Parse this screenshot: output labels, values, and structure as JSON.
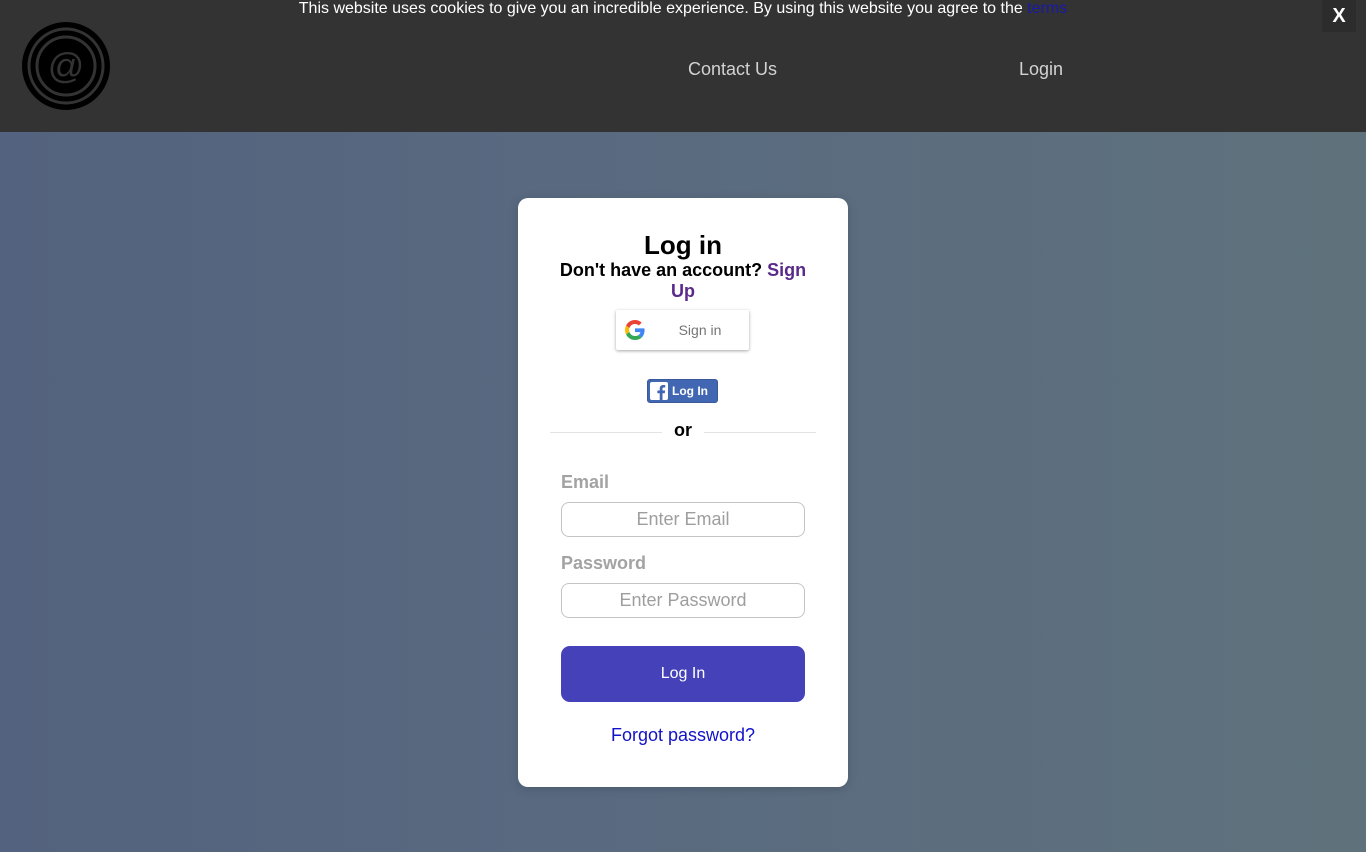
{
  "cookie_banner": {
    "text": "This website uses cookies to give you an incredible experience. By using this website you agree to the",
    "link_text": "terms",
    "close_label": "X"
  },
  "nav": {
    "logo_icon": "at-sign-target-icon",
    "contact_label": "Contact Us",
    "login_label": "Login"
  },
  "login_card": {
    "title": "Log in",
    "no_account_text": "Don't have an account?",
    "sign_up_label": "Sign Up",
    "google_label": "Sign in",
    "facebook_label": "Log In",
    "divider_text": "or",
    "email_label": "Email",
    "email_placeholder": "Enter Email",
    "email_value": "",
    "password_label": "Password",
    "password_placeholder": "Enter Password",
    "password_value": "",
    "submit_label": "Log In",
    "forgot_label": "Forgot password?"
  },
  "colors": {
    "topbar": "#333333",
    "primary_button": "#4541b9",
    "sign_up_link": "#5a2a8a",
    "forgot_link": "#1212c8",
    "facebook": "#4267b2"
  }
}
